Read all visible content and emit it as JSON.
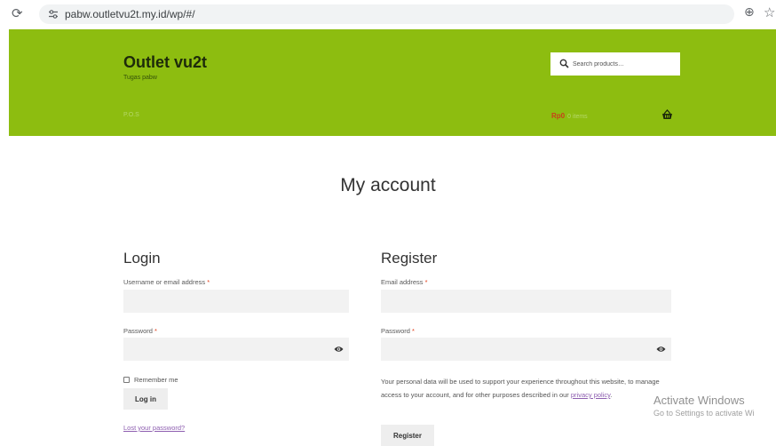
{
  "browser": {
    "url": "pabw.outletvu2t.my.id/wp/#/"
  },
  "header": {
    "site_title": "Outlet vu2t",
    "tagline": "Tugas pabw",
    "search_placeholder": "Search products…",
    "nav_item": "P.O.S",
    "cart_amount": "Rp0",
    "cart_items": "0 items"
  },
  "main": {
    "page_title": "My account"
  },
  "login": {
    "title": "Login",
    "username_label": "Username or email address",
    "password_label": "Password",
    "remember_label": "Remember me",
    "login_button": "Log in",
    "lost_password": "Lost your password?"
  },
  "register": {
    "title": "Register",
    "email_label": "Email address",
    "password_label": "Password",
    "privacy_text": "Your personal data will be used to support your experience throughout this website, to manage access to your account, and for other purposes described in our ",
    "privacy_link": "privacy policy",
    "privacy_end": ".",
    "register_button": "Register"
  },
  "required_mark": "*",
  "watermark": {
    "title": "Activate Windows",
    "subtitle": "Go to Settings to activate Wi"
  },
  "icons": {
    "reload": "reload-icon",
    "site_settings": "site-settings-icon",
    "zoom": "zoom-icon",
    "bookmark": "bookmark-star-icon",
    "search": "search-icon",
    "basket": "basket-icon",
    "eye": "eye-icon"
  },
  "colors": {
    "header_bg": "#8dbd10",
    "required": "#e2401c",
    "link": "#8e5fb0",
    "cart_amount": "#c8401a"
  }
}
